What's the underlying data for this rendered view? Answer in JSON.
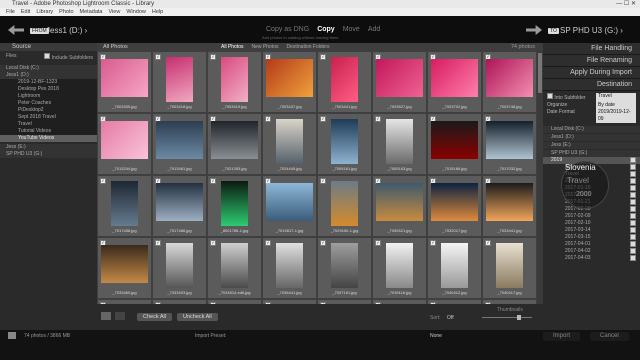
{
  "window": {
    "title": "Travel - Adobe Photoshop Lightroom Classic - Library",
    "controls": "— ☐ ✕"
  },
  "menu": [
    "File",
    "Edit",
    "Library",
    "Photo",
    "Metadata",
    "View",
    "Window",
    "Help"
  ],
  "top": {
    "from_label": "FROM",
    "source": "Jess1 (D:) ›",
    "to_label": "TO",
    "destination": "SP PHD U3 (G:) ›",
    "modes": [
      "Copy as DNG",
      "Copy",
      "Move",
      "Add"
    ],
    "active_mode": "Copy",
    "mode_sub": "Add photos to catalog without moving them"
  },
  "left": {
    "header": "Source",
    "files_label": "Files",
    "include_sub": "Include Subfolders",
    "volumes": [
      "Local Disk (C:)",
      "Jess1 (D:)"
    ],
    "folders": [
      "2019-12-BF-1323",
      "Desktop Pes 2018",
      "Lightroom",
      "Peter Coaches",
      "PiDesktop2",
      "Sept 2018 Travel",
      "Travel",
      "Tutorial Videos",
      "YouTube Videos"
    ],
    "selected_folder": "YouTube Videos",
    "other_volumes": [
      "Jess (E:)",
      "SP PHD U3 (G:)"
    ]
  },
  "center": {
    "tab": "All Photos",
    "filters": [
      "All Photos",
      "New Photos",
      "Destination Folders"
    ],
    "active_filter": "All Photos",
    "count": "74 photos",
    "rows": [
      [
        "_7003305.jpg",
        "_7003418.jpg",
        "_7003419.jpg",
        "_7003437.jpg",
        "_7003441.jpg",
        "_7003527.jpg",
        "_7003702.jpg",
        "_7003748.jpg"
      ],
      [
        "_7013244.jpg",
        "_7013481.jpg",
        "_7021393.jpg",
        "_7024449.jpg",
        "_7005161.jpg",
        "_7005163.jpg",
        "_7015166.jpg",
        "_7017032.jpg"
      ],
      [
        "_7017458.jpg",
        "_7017486.jpg",
        "_8001786-1.jpg",
        "_7019817-1.jpg",
        "_7029150-1.jpg",
        "_7030521.jpg",
        "_7032017.jpg",
        "_7033441.jpg"
      ],
      [
        "_7033460.jpg",
        "_7033493.jpg",
        "_7034514-edit.jpg",
        "_7036441.jpg",
        "_7037161.jpg",
        "_7039116.jpg",
        "_7040412.jpg",
        "_7040417.jpg"
      ],
      [
        "",
        "",
        "",
        "",
        "",
        "",
        "",
        ""
      ]
    ],
    "check_all": "Check All",
    "uncheck_all": "Uncheck All",
    "sort_label": "Sort:",
    "sort_value": "Off",
    "thumbnails_label": "Thumbnails"
  },
  "right": {
    "panels": [
      "File Handling",
      "File Renaming",
      "Apply During Import",
      "Destination"
    ],
    "into_subfolder": "Into Subfolder",
    "subfolder_name": "Travel",
    "organize_label": "Organize",
    "organize_value": "By date",
    "date_format_label": "Date Format",
    "date_format_value": "2019/2019-12-09",
    "volumes": [
      "Local Disk (C:)",
      "Jess1 (D:)",
      "Jess (E:)",
      "SP PHD U3 (G:)"
    ],
    "year": "2019",
    "tree": [
      "Slovenia",
      "Travel",
      "2000",
      "2017-01-19",
      "2017-01-20",
      "2017-01-21",
      "2017-02-08",
      "2017-02-09",
      "2017-02-10",
      "2017-03-14",
      "2017-03-15",
      "2017-04-01",
      "2017-04-02",
      "2017-04-03"
    ]
  },
  "overlay": {
    "line1": "Slovenia",
    "line2": "Travel",
    "line3": "2000"
  },
  "bottom": {
    "info": "74 photos / 3866 MB",
    "preset_label": "Import Preset:",
    "preset_value": "None",
    "import": "Import",
    "cancel": "Cancel"
  }
}
